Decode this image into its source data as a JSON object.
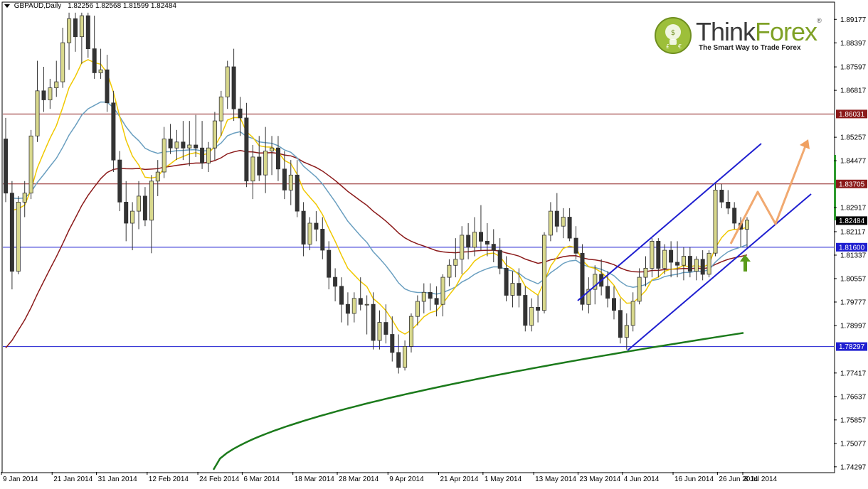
{
  "header": {
    "symbol": "GBPAUD,Daily",
    "ohlc": "1.82256 1.82568 1.81599 1.82484"
  },
  "logo": {
    "name_part1": "Think",
    "name_part2": "Forex",
    "registered": "®",
    "tagline": "The Smart Way to Trade Forex"
  },
  "colors": {
    "bull_candle": "#d8d88c",
    "bear_candle": "#333333",
    "ema_fast": "#f0c800",
    "ema_mid": "#6a9fc0",
    "ma_slow": "#8b1a1a",
    "ma_long": "#1b7a1b",
    "channel": "#1f1fd0",
    "resistance": "#8b1a1a",
    "support": "#1f1fd0",
    "projection": "#f0a060"
  },
  "chart_data": {
    "type": "candlestick",
    "symbol": "GBPAUD",
    "timeframe": "Daily",
    "price_axis_ticks": [
      "1.89177",
      "1.88397",
      "1.87597",
      "1.86817",
      "1.86031",
      "1.85257",
      "1.84477",
      "1.83705",
      "1.82917",
      "1.82484",
      "1.82117",
      "1.81600",
      "1.81337",
      "1.80557",
      "1.79777",
      "1.78997",
      "1.78297",
      "1.77417",
      "1.76637",
      "1.75857",
      "1.75077",
      "1.74297"
    ],
    "highlighted_levels": [
      {
        "label": "1.86031",
        "value": 1.86031,
        "kind": "resistance",
        "color": "#8b1a1a"
      },
      {
        "label": "1.83705",
        "value": 1.83705,
        "kind": "resistance",
        "color": "#8b1a1a"
      },
      {
        "label": "1.82484",
        "value": 1.82484,
        "kind": "current",
        "color": "#000000"
      },
      {
        "label": "1.81600",
        "value": 1.816,
        "kind": "support",
        "color": "#1f1fd0"
      },
      {
        "label": "1.78297",
        "value": 1.78297,
        "kind": "support",
        "color": "#1f1fd0"
      }
    ],
    "date_labels": [
      "9 Jan 2014",
      "21 Jan 2014",
      "31 Jan 2014",
      "12 Feb 2014",
      "24 Feb 2014",
      "6 Mar 2014",
      "18 Mar 2014",
      "28 Mar 2014",
      "9 Apr 2014",
      "21 Apr 2014",
      "1 May 2014",
      "13 May 2014",
      "23 May 2014",
      "4 Jun 2014",
      "16 Jun 2014",
      "26 Jun 2014",
      "8 Jul 2014"
    ],
    "candles": [
      {
        "o": 1.852,
        "h": 1.859,
        "l": 1.831,
        "c": 1.834
      },
      {
        "o": 1.834,
        "h": 1.838,
        "l": 1.802,
        "c": 1.808
      },
      {
        "o": 1.808,
        "h": 1.833,
        "l": 1.807,
        "c": 1.831
      },
      {
        "o": 1.831,
        "h": 1.838,
        "l": 1.826,
        "c": 1.834
      },
      {
        "o": 1.834,
        "h": 1.855,
        "l": 1.832,
        "c": 1.853
      },
      {
        "o": 1.853,
        "h": 1.878,
        "l": 1.851,
        "c": 1.868
      },
      {
        "o": 1.868,
        "h": 1.876,
        "l": 1.861,
        "c": 1.865
      },
      {
        "o": 1.865,
        "h": 1.872,
        "l": 1.862,
        "c": 1.869
      },
      {
        "o": 1.869,
        "h": 1.878,
        "l": 1.866,
        "c": 1.871
      },
      {
        "o": 1.871,
        "h": 1.889,
        "l": 1.869,
        "c": 1.884
      },
      {
        "o": 1.884,
        "h": 1.894,
        "l": 1.875,
        "c": 1.892
      },
      {
        "o": 1.892,
        "h": 1.894,
        "l": 1.881,
        "c": 1.886
      },
      {
        "o": 1.886,
        "h": 1.894,
        "l": 1.877,
        "c": 1.893
      },
      {
        "o": 1.893,
        "h": 1.894,
        "l": 1.879,
        "c": 1.882
      },
      {
        "o": 1.882,
        "h": 1.893,
        "l": 1.872,
        "c": 1.874
      },
      {
        "o": 1.874,
        "h": 1.882,
        "l": 1.872,
        "c": 1.875
      },
      {
        "o": 1.875,
        "h": 1.88,
        "l": 1.861,
        "c": 1.864
      },
      {
        "o": 1.864,
        "h": 1.868,
        "l": 1.841,
        "c": 1.845
      },
      {
        "o": 1.845,
        "h": 1.848,
        "l": 1.828,
        "c": 1.831
      },
      {
        "o": 1.831,
        "h": 1.838,
        "l": 1.818,
        "c": 1.824
      },
      {
        "o": 1.824,
        "h": 1.831,
        "l": 1.815,
        "c": 1.828
      },
      {
        "o": 1.828,
        "h": 1.838,
        "l": 1.822,
        "c": 1.833
      },
      {
        "o": 1.833,
        "h": 1.836,
        "l": 1.823,
        "c": 1.825
      },
      {
        "o": 1.825,
        "h": 1.84,
        "l": 1.814,
        "c": 1.838
      },
      {
        "o": 1.838,
        "h": 1.845,
        "l": 1.833,
        "c": 1.841
      },
      {
        "o": 1.841,
        "h": 1.856,
        "l": 1.839,
        "c": 1.852
      },
      {
        "o": 1.852,
        "h": 1.857,
        "l": 1.847,
        "c": 1.849
      },
      {
        "o": 1.849,
        "h": 1.855,
        "l": 1.845,
        "c": 1.851
      },
      {
        "o": 1.851,
        "h": 1.858,
        "l": 1.845,
        "c": 1.849
      },
      {
        "o": 1.849,
        "h": 1.858,
        "l": 1.843,
        "c": 1.85
      },
      {
        "o": 1.85,
        "h": 1.86,
        "l": 1.846,
        "c": 1.849
      },
      {
        "o": 1.849,
        "h": 1.858,
        "l": 1.842,
        "c": 1.844
      },
      {
        "o": 1.844,
        "h": 1.851,
        "l": 1.841,
        "c": 1.849
      },
      {
        "o": 1.849,
        "h": 1.861,
        "l": 1.845,
        "c": 1.858
      },
      {
        "o": 1.858,
        "h": 1.868,
        "l": 1.853,
        "c": 1.866
      },
      {
        "o": 1.866,
        "h": 1.878,
        "l": 1.862,
        "c": 1.876
      },
      {
        "o": 1.876,
        "h": 1.882,
        "l": 1.858,
        "c": 1.862
      },
      {
        "o": 1.862,
        "h": 1.866,
        "l": 1.853,
        "c": 1.859
      },
      {
        "o": 1.859,
        "h": 1.864,
        "l": 1.836,
        "c": 1.838
      },
      {
        "o": 1.838,
        "h": 1.85,
        "l": 1.832,
        "c": 1.846
      },
      {
        "o": 1.846,
        "h": 1.853,
        "l": 1.838,
        "c": 1.84
      },
      {
        "o": 1.84,
        "h": 1.856,
        "l": 1.834,
        "c": 1.848
      },
      {
        "o": 1.848,
        "h": 1.853,
        "l": 1.84,
        "c": 1.849
      },
      {
        "o": 1.849,
        "h": 1.853,
        "l": 1.838,
        "c": 1.842
      },
      {
        "o": 1.842,
        "h": 1.848,
        "l": 1.832,
        "c": 1.835
      },
      {
        "o": 1.835,
        "h": 1.845,
        "l": 1.83,
        "c": 1.84
      },
      {
        "o": 1.84,
        "h": 1.845,
        "l": 1.826,
        "c": 1.828
      },
      {
        "o": 1.828,
        "h": 1.831,
        "l": 1.813,
        "c": 1.817
      },
      {
        "o": 1.817,
        "h": 1.826,
        "l": 1.815,
        "c": 1.824
      },
      {
        "o": 1.824,
        "h": 1.828,
        "l": 1.818,
        "c": 1.822
      },
      {
        "o": 1.822,
        "h": 1.826,
        "l": 1.812,
        "c": 1.815
      },
      {
        "o": 1.815,
        "h": 1.818,
        "l": 1.802,
        "c": 1.806
      },
      {
        "o": 1.806,
        "h": 1.809,
        "l": 1.798,
        "c": 1.803
      },
      {
        "o": 1.803,
        "h": 1.806,
        "l": 1.791,
        "c": 1.797
      },
      {
        "o": 1.797,
        "h": 1.801,
        "l": 1.79,
        "c": 1.794
      },
      {
        "o": 1.794,
        "h": 1.801,
        "l": 1.791,
        "c": 1.799
      },
      {
        "o": 1.799,
        "h": 1.806,
        "l": 1.795,
        "c": 1.797
      },
      {
        "o": 1.797,
        "h": 1.8,
        "l": 1.787,
        "c": 1.797
      },
      {
        "o": 1.797,
        "h": 1.801,
        "l": 1.782,
        "c": 1.785
      },
      {
        "o": 1.785,
        "h": 1.795,
        "l": 1.782,
        "c": 1.791
      },
      {
        "o": 1.791,
        "h": 1.797,
        "l": 1.784,
        "c": 1.787
      },
      {
        "o": 1.787,
        "h": 1.793,
        "l": 1.778,
        "c": 1.781
      },
      {
        "o": 1.781,
        "h": 1.787,
        "l": 1.774,
        "c": 1.776
      },
      {
        "o": 1.776,
        "h": 1.785,
        "l": 1.775,
        "c": 1.783
      },
      {
        "o": 1.783,
        "h": 1.794,
        "l": 1.781,
        "c": 1.793
      },
      {
        "o": 1.793,
        "h": 1.8,
        "l": 1.79,
        "c": 1.798
      },
      {
        "o": 1.798,
        "h": 1.804,
        "l": 1.794,
        "c": 1.801
      },
      {
        "o": 1.801,
        "h": 1.804,
        "l": 1.795,
        "c": 1.799
      },
      {
        "o": 1.799,
        "h": 1.803,
        "l": 1.793,
        "c": 1.797
      },
      {
        "o": 1.797,
        "h": 1.807,
        "l": 1.793,
        "c": 1.806
      },
      {
        "o": 1.806,
        "h": 1.812,
        "l": 1.803,
        "c": 1.81
      },
      {
        "o": 1.81,
        "h": 1.819,
        "l": 1.806,
        "c": 1.812
      },
      {
        "o": 1.812,
        "h": 1.823,
        "l": 1.807,
        "c": 1.82
      },
      {
        "o": 1.82,
        "h": 1.824,
        "l": 1.812,
        "c": 1.816
      },
      {
        "o": 1.816,
        "h": 1.826,
        "l": 1.813,
        "c": 1.821
      },
      {
        "o": 1.821,
        "h": 1.83,
        "l": 1.815,
        "c": 1.818
      },
      {
        "o": 1.818,
        "h": 1.824,
        "l": 1.813,
        "c": 1.817
      },
      {
        "o": 1.817,
        "h": 1.822,
        "l": 1.811,
        "c": 1.815
      },
      {
        "o": 1.815,
        "h": 1.819,
        "l": 1.807,
        "c": 1.809
      },
      {
        "o": 1.809,
        "h": 1.813,
        "l": 1.798,
        "c": 1.8
      },
      {
        "o": 1.8,
        "h": 1.808,
        "l": 1.796,
        "c": 1.804
      },
      {
        "o": 1.804,
        "h": 1.809,
        "l": 1.796,
        "c": 1.8
      },
      {
        "o": 1.8,
        "h": 1.803,
        "l": 1.788,
        "c": 1.79
      },
      {
        "o": 1.79,
        "h": 1.799,
        "l": 1.788,
        "c": 1.796
      },
      {
        "o": 1.796,
        "h": 1.8,
        "l": 1.791,
        "c": 1.795
      },
      {
        "o": 1.795,
        "h": 1.821,
        "l": 1.794,
        "c": 1.82
      },
      {
        "o": 1.82,
        "h": 1.831,
        "l": 1.818,
        "c": 1.828
      },
      {
        "o": 1.828,
        "h": 1.834,
        "l": 1.821,
        "c": 1.823
      },
      {
        "o": 1.823,
        "h": 1.829,
        "l": 1.819,
        "c": 1.826
      },
      {
        "o": 1.826,
        "h": 1.829,
        "l": 1.818,
        "c": 1.819
      },
      {
        "o": 1.819,
        "h": 1.823,
        "l": 1.812,
        "c": 1.814
      },
      {
        "o": 1.814,
        "h": 1.817,
        "l": 1.795,
        "c": 1.797
      },
      {
        "o": 1.797,
        "h": 1.806,
        "l": 1.794,
        "c": 1.802
      },
      {
        "o": 1.802,
        "h": 1.81,
        "l": 1.797,
        "c": 1.807
      },
      {
        "o": 1.807,
        "h": 1.812,
        "l": 1.8,
        "c": 1.803
      },
      {
        "o": 1.803,
        "h": 1.808,
        "l": 1.796,
        "c": 1.799
      },
      {
        "o": 1.799,
        "h": 1.803,
        "l": 1.792,
        "c": 1.795
      },
      {
        "o": 1.795,
        "h": 1.799,
        "l": 1.784,
        "c": 1.786
      },
      {
        "o": 1.786,
        "h": 1.794,
        "l": 1.782,
        "c": 1.79
      },
      {
        "o": 1.79,
        "h": 1.801,
        "l": 1.788,
        "c": 1.798
      },
      {
        "o": 1.798,
        "h": 1.809,
        "l": 1.797,
        "c": 1.806
      },
      {
        "o": 1.806,
        "h": 1.813,
        "l": 1.803,
        "c": 1.809
      },
      {
        "o": 1.809,
        "h": 1.819,
        "l": 1.806,
        "c": 1.818
      },
      {
        "o": 1.818,
        "h": 1.819,
        "l": 1.806,
        "c": 1.809
      },
      {
        "o": 1.809,
        "h": 1.817,
        "l": 1.807,
        "c": 1.815
      },
      {
        "o": 1.815,
        "h": 1.818,
        "l": 1.806,
        "c": 1.811
      },
      {
        "o": 1.811,
        "h": 1.818,
        "l": 1.806,
        "c": 1.81
      },
      {
        "o": 1.81,
        "h": 1.816,
        "l": 1.805,
        "c": 1.813
      },
      {
        "o": 1.813,
        "h": 1.816,
        "l": 1.806,
        "c": 1.808
      },
      {
        "o": 1.808,
        "h": 1.813,
        "l": 1.805,
        "c": 1.812
      },
      {
        "o": 1.812,
        "h": 1.815,
        "l": 1.805,
        "c": 1.807
      },
      {
        "o": 1.807,
        "h": 1.815,
        "l": 1.806,
        "c": 1.814
      },
      {
        "o": 1.814,
        "h": 1.837,
        "l": 1.813,
        "c": 1.835
      },
      {
        "o": 1.835,
        "h": 1.837,
        "l": 1.829,
        "c": 1.831
      },
      {
        "o": 1.831,
        "h": 1.835,
        "l": 1.827,
        "c": 1.829
      },
      {
        "o": 1.829,
        "h": 1.831,
        "l": 1.822,
        "c": 1.824
      },
      {
        "o": 1.824,
        "h": 1.826,
        "l": 1.816,
        "c": 1.822
      },
      {
        "o": 1.822,
        "h": 1.826,
        "l": 1.816,
        "c": 1.825
      }
    ],
    "overlays": [
      {
        "name": "fast_ma",
        "color": "#f0c800"
      },
      {
        "name": "mid_ma",
        "color": "#6a9fc0"
      },
      {
        "name": "slow_ma",
        "color": "#8b1a1a"
      },
      {
        "name": "long_ma",
        "color": "#1b7a1b"
      }
    ],
    "annotations": [
      "ascending channel (blue parallel lines)",
      "upward zig-zag projection arrow (orange)",
      "green up arrow at channel support"
    ]
  }
}
